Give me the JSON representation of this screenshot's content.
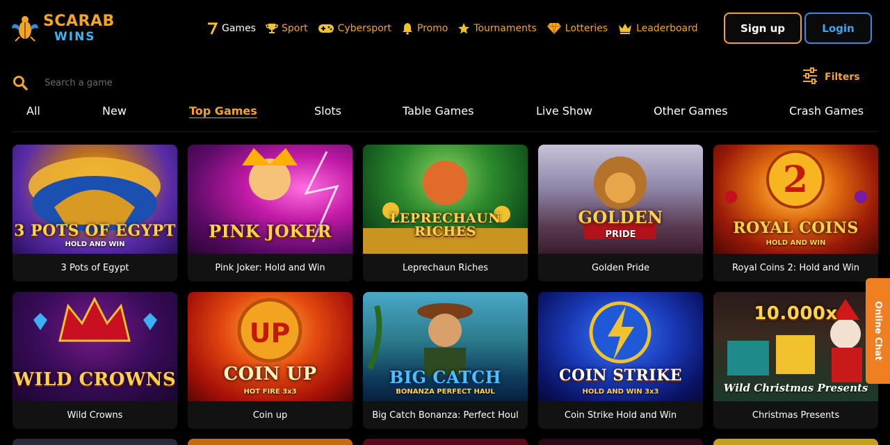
{
  "logo": {
    "line1": "SCARAB",
    "line2": "WINS"
  },
  "nav": [
    {
      "label": "Games",
      "icon": "seven-icon",
      "active": true
    },
    {
      "label": "Sport",
      "icon": "trophy-icon"
    },
    {
      "label": "Cybersport",
      "icon": "gamepad-icon"
    },
    {
      "label": "Promo",
      "icon": "bell-icon"
    },
    {
      "label": "Tournaments",
      "icon": "star-icon"
    },
    {
      "label": "Lotteries",
      "icon": "diamond-icon"
    },
    {
      "label": "Leaderboard",
      "icon": "crown-icon"
    }
  ],
  "auth": {
    "signup": "Sign up",
    "login": "Login"
  },
  "search": {
    "placeholder": "Search a game"
  },
  "filters": {
    "label": "Filters"
  },
  "tabs": [
    {
      "label": "All"
    },
    {
      "label": "New"
    },
    {
      "label": "Top Games",
      "active": true
    },
    {
      "label": "Slots"
    },
    {
      "label": "Table Games"
    },
    {
      "label": "Live Show"
    },
    {
      "label": "Other Games"
    },
    {
      "label": "Crash Games"
    }
  ],
  "games": [
    {
      "title": "3 Pots of Egypt",
      "art_text": "3 POTS OF EGYPT",
      "art_sub": "HOLD AND WIN"
    },
    {
      "title": "Pink Joker: Hold and Win",
      "art_text": "PINK JOKER",
      "art_sub": ""
    },
    {
      "title": "Leprechaun Riches",
      "art_text": "LEPRECHAUN RICHES",
      "art_sub": ""
    },
    {
      "title": "Golden Pride",
      "art_text": "GOLDEN",
      "art_sub": "PRIDE"
    },
    {
      "title": "Royal Coins 2: Hold and Win",
      "art_text": "ROYAL COINS",
      "art_sub": "HOLD AND WIN"
    },
    {
      "title": "Wild Crowns",
      "art_text": "WILD CROWNS",
      "art_sub": ""
    },
    {
      "title": "Coin up",
      "art_text": "COIN UP",
      "art_sub": "HOT FIRE 3x3"
    },
    {
      "title": "Big Catch Bonanza: Perfect Houl",
      "art_text": "BIG CATCH",
      "art_sub": "BONANZA PERFECT HAUL"
    },
    {
      "title": "Coin Strike Hold and Win",
      "art_text": "COIN STRIKE",
      "art_sub": "HOLD AND WIN 3x3"
    },
    {
      "title": "Christmas Presents",
      "art_text": "10.000x",
      "art_sub": "Wild Christmas Presents"
    }
  ],
  "online_chat": {
    "label": "Online Chat"
  },
  "colors": {
    "accent": "#f2a623",
    "login": "#2f8fe0",
    "chat": "#f07f22",
    "background": "#000000"
  }
}
